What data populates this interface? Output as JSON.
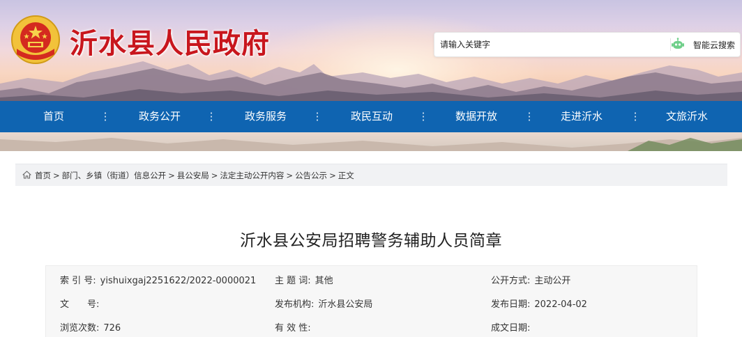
{
  "header": {
    "site_title": "沂水县人民政府",
    "search": {
      "placeholder": "请输入关键字",
      "button_label": "智能云搜索",
      "button_icon": "robot-icon"
    },
    "colors": {
      "title": "#c8161d",
      "nav_bg": "#0f64b1"
    }
  },
  "nav": {
    "items": [
      {
        "label": "首页"
      },
      {
        "label": "政务公开"
      },
      {
        "label": "政务服务"
      },
      {
        "label": "政民互动"
      },
      {
        "label": "数据开放"
      },
      {
        "label": "走进沂水"
      },
      {
        "label": "文旅沂水"
      }
    ]
  },
  "breadcrumb": {
    "icon": "home-icon",
    "items": [
      "首页",
      "部门、乡镇（街道）信息公开",
      "县公安局",
      "法定主动公开内容",
      "公告公示",
      "正文"
    ],
    "separator": ">"
  },
  "article": {
    "title": "沂水县公安局招聘警务辅助人员简章"
  },
  "metadata": {
    "rows": [
      [
        {
          "label": "索 引 号:",
          "value": "yishuixgaj2251622/2022-0000021"
        },
        {
          "label": "主 题 词:",
          "value": "其他"
        },
        {
          "label": "公开方式:",
          "value": "主动公开"
        }
      ],
      [
        {
          "label": "文　　号:",
          "value": ""
        },
        {
          "label": "发布机构:",
          "value": "沂水县公安局"
        },
        {
          "label": "发布日期:",
          "value": "2022-04-02"
        }
      ],
      [
        {
          "label": "浏览次数:",
          "value": "726"
        },
        {
          "label": "有 效 性:",
          "value": ""
        },
        {
          "label": "成文日期:",
          "value": ""
        }
      ]
    ]
  }
}
